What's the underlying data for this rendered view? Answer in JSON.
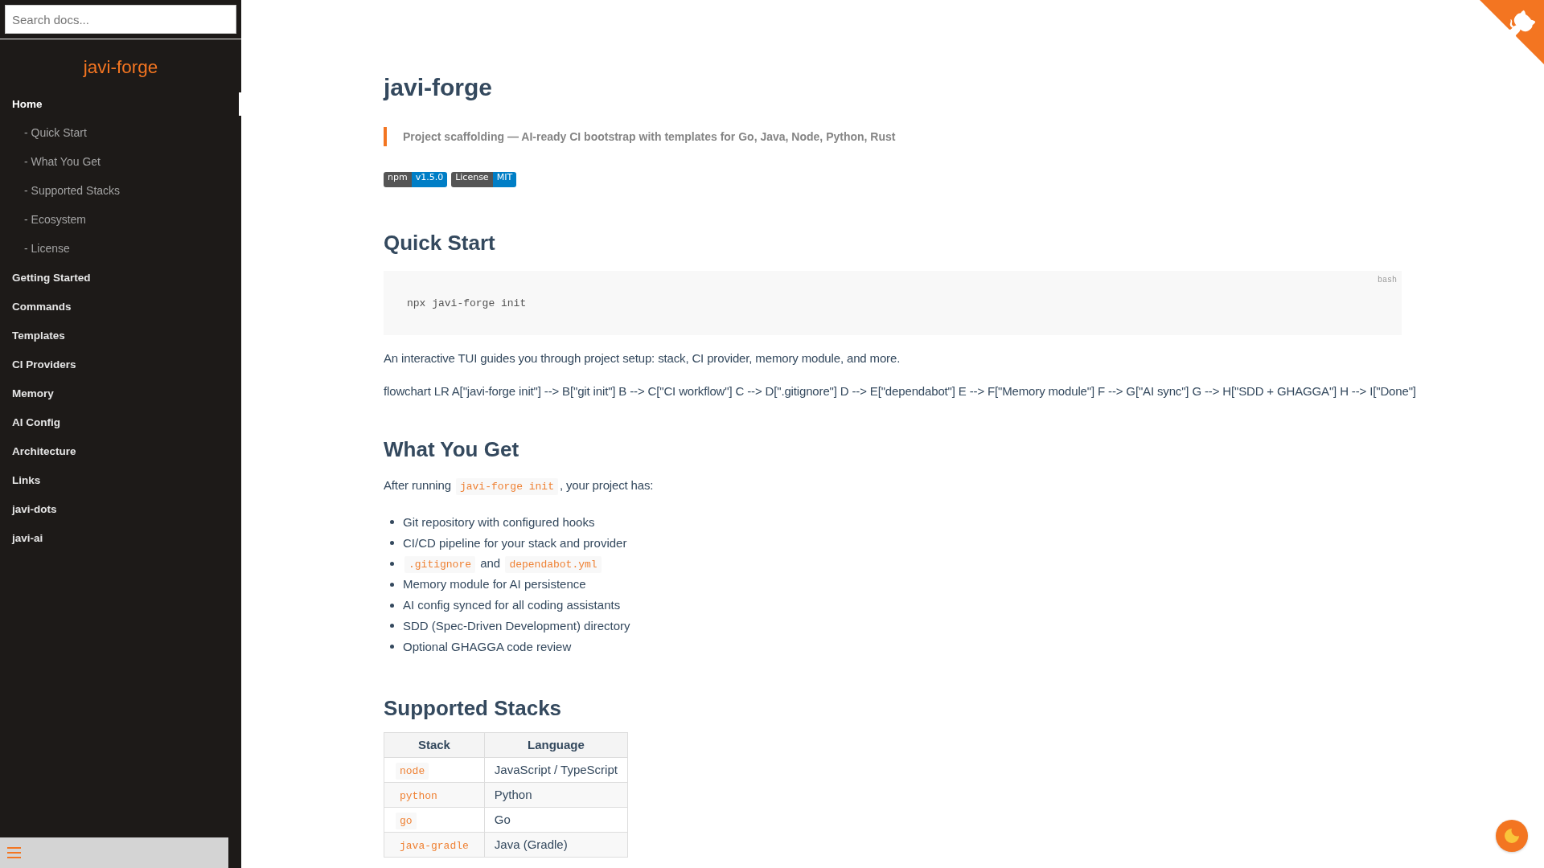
{
  "sidebar": {
    "search": {
      "placeholder": "Search docs..."
    },
    "app_name": "javi-forge",
    "items": [
      {
        "label": "Home",
        "selected": true,
        "children": [
          {
            "label": "- Quick Start",
            "selected": false
          },
          {
            "label": "- What You Get",
            "selected": false
          },
          {
            "label": "- Supported Stacks",
            "selected": false
          },
          {
            "label": "- Ecosystem",
            "selected": false
          },
          {
            "label": "- License",
            "selected": false
          }
        ]
      },
      {
        "label": "Getting Started",
        "selected": false
      },
      {
        "label": "Commands",
        "selected": false
      },
      {
        "label": "Templates",
        "selected": false
      },
      {
        "label": "CI Providers",
        "selected": false
      },
      {
        "label": "Memory",
        "selected": false
      },
      {
        "label": "AI Config",
        "selected": false
      },
      {
        "label": "Architecture",
        "selected": false
      },
      {
        "label": "Links",
        "selected": false
      },
      {
        "label": "javi-dots",
        "selected": false
      },
      {
        "label": "javi-ai",
        "selected": false
      }
    ]
  },
  "content": {
    "title": "javi-forge",
    "tagline": "Project scaffolding — AI-ready CI bootstrap with templates for Go, Java, Node, Python, Rust",
    "badges": [
      {
        "label": "npm",
        "value": "v1.5.0"
      },
      {
        "label": "License",
        "value": "MIT"
      }
    ],
    "blocks": [
      {
        "kind": "heading",
        "text": "Quick Start"
      },
      {
        "kind": "code_block",
        "language": "bash",
        "code": "npx javi-forge init"
      },
      {
        "kind": "paragraph",
        "parts": [
          {
            "kind": "text",
            "text": "An interactive TUI guides you through project setup: stack, CI provider, memory module, and more."
          }
        ]
      },
      {
        "kind": "paragraph",
        "parts": [
          {
            "kind": "text",
            "text": "flowchart LR A[\"javi-forge init\"] --> B[\"git init\"] B --> C[\"CI workflow\"] C --> D[\".gitignore\"] D --> E[\"dependabot\"] E --> F[\"Memory module\"] F --> G[\"AI sync\"] G --> H[\"SDD + GHAGGA\"] H --> I[\"Done\"]"
          }
        ]
      },
      {
        "kind": "heading",
        "text": "What You Get"
      },
      {
        "kind": "paragraph",
        "parts": [
          {
            "kind": "text",
            "text": "After running "
          },
          {
            "kind": "code",
            "text": "javi-forge init"
          },
          {
            "kind": "text",
            "text": ", your project has:"
          }
        ]
      },
      {
        "kind": "list",
        "items": [
          {
            "parts": [
              {
                "kind": "text",
                "text": "Git repository with configured hooks"
              }
            ]
          },
          {
            "parts": [
              {
                "kind": "text",
                "text": "CI/CD pipeline for your stack and provider"
              }
            ]
          },
          {
            "parts": [
              {
                "kind": "code",
                "text": ".gitignore"
              },
              {
                "kind": "text",
                "text": " and "
              },
              {
                "kind": "code",
                "text": "dependabot.yml"
              }
            ]
          },
          {
            "parts": [
              {
                "kind": "text",
                "text": "Memory module for AI persistence"
              }
            ]
          },
          {
            "parts": [
              {
                "kind": "text",
                "text": "AI config synced for all coding assistants"
              }
            ]
          },
          {
            "parts": [
              {
                "kind": "text",
                "text": "SDD (Spec-Driven Development) directory"
              }
            ]
          },
          {
            "parts": [
              {
                "kind": "text",
                "text": "Optional GHAGGA code review"
              }
            ]
          }
        ]
      },
      {
        "kind": "heading",
        "text": "Supported Stacks"
      },
      {
        "kind": "table",
        "columns": [
          "Stack",
          "Language"
        ],
        "rows": [
          [
            "node",
            "JavaScript / TypeScript"
          ],
          [
            "python",
            "Python"
          ],
          [
            "go",
            "Go"
          ],
          [
            "java-gradle",
            "Java (Gradle)"
          ]
        ]
      }
    ]
  }
}
